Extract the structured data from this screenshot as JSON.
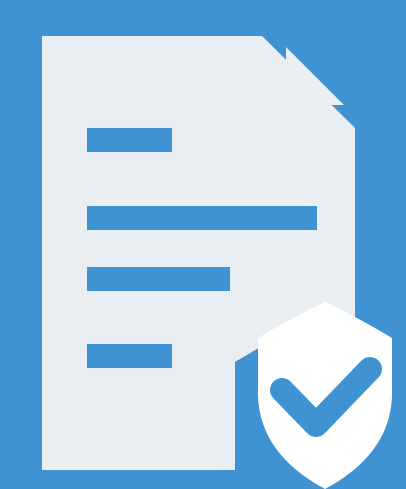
{
  "icon": {
    "name": "secure-document-icon",
    "background_color": "#3f93d2",
    "document_color": "#e8eef2",
    "line_color": "#3f93d2",
    "shield_color": "#ffffff",
    "check_color": "#3f93d2"
  }
}
